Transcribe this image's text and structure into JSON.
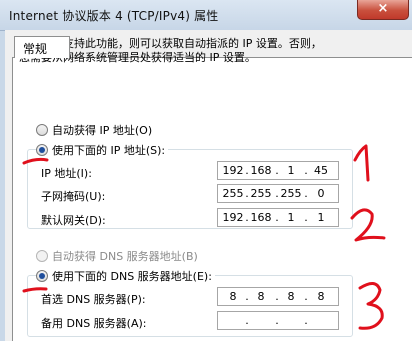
{
  "window": {
    "title": "Internet 协议版本 4 (TCP/IPv4) 属性",
    "close_glyph": "×"
  },
  "tabs": [
    {
      "label": "常规"
    }
  ],
  "description": "如果网络支持此功能，则可以获取自动指派的 IP 设置。否则，\n您需要从网络系统管理员处获得适当的 IP 设置。",
  "ip_section": {
    "auto_label": "自动获得 IP 地址(O)",
    "manual_label": "使用下面的 IP 地址(S):",
    "selected": "manual",
    "fields": [
      {
        "label": "IP 地址(I):",
        "octets": [
          "192",
          "168",
          "1",
          "45"
        ]
      },
      {
        "label": "子网掩码(U):",
        "octets": [
          "255",
          "255",
          "255",
          "0"
        ]
      },
      {
        "label": "默认网关(D):",
        "octets": [
          "192",
          "168",
          "1",
          "1"
        ]
      }
    ]
  },
  "dns_section": {
    "auto_label": "自动获得 DNS 服务器地址(B)",
    "auto_disabled": true,
    "manual_label": "使用下面的 DNS 服务器地址(E):",
    "selected": "manual",
    "fields": [
      {
        "label": "首选 DNS 服务器(P):",
        "octets": [
          "8",
          "8",
          "8",
          "8"
        ]
      },
      {
        "label": "备用 DNS 服务器(A):",
        "octets": [
          "",
          "",
          "",
          ""
        ]
      }
    ]
  },
  "annotations": {
    "numbers": [
      "1",
      "2",
      "3"
    ],
    "color": "#e0101c"
  }
}
